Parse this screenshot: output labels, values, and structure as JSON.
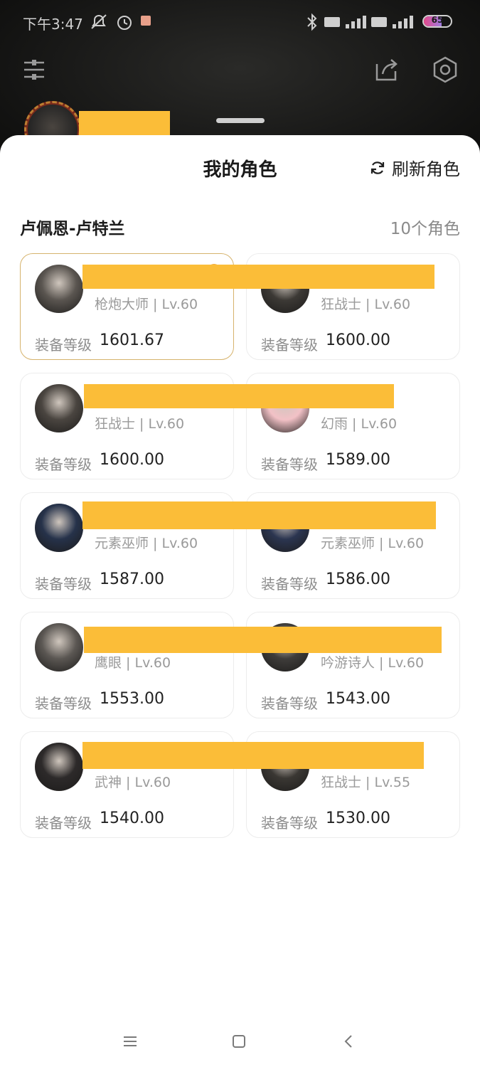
{
  "status": {
    "time": "下午3:47",
    "battery": "65",
    "battery_level": 0.65
  },
  "sheet": {
    "title": "我的角色",
    "refresh_label": "刷新角色",
    "server_name": "卢佩恩-卢特兰",
    "role_count": "10个角色"
  },
  "gear_label": "装备等级",
  "characters": [
    {
      "class_level": "枪炮大师 | Lv.60",
      "gear_score": "1601.67",
      "selected": true,
      "avatar_color": "#5a5550"
    },
    {
      "class_level": "狂战士 | Lv.60",
      "gear_score": "1600.00",
      "selected": false,
      "avatar_color": "#3c3935"
    },
    {
      "class_level": "狂战士 | Lv.60",
      "gear_score": "1600.00",
      "selected": false,
      "avatar_color": "#4a4540"
    },
    {
      "class_level": "幻雨 | Lv.60",
      "gear_score": "1589.00",
      "selected": false,
      "avatar_color": "#f2c1c6"
    },
    {
      "class_level": "元素巫师 | Lv.60",
      "gear_score": "1587.00",
      "selected": false,
      "avatar_color": "#26324a"
    },
    {
      "class_level": "元素巫师 | Lv.60",
      "gear_score": "1586.00",
      "selected": false,
      "avatar_color": "#2b3550"
    },
    {
      "class_level": "鹰眼 | Lv.60",
      "gear_score": "1553.00",
      "selected": false,
      "avatar_color": "#5b5753"
    },
    {
      "class_level": "吟游诗人 | Lv.60",
      "gear_score": "1543.00",
      "selected": false,
      "avatar_color": "#3e3c3a"
    },
    {
      "class_level": "武神 | Lv.60",
      "gear_score": "1540.00",
      "selected": false,
      "avatar_color": "#2d2a2a"
    },
    {
      "class_level": "狂战士 | Lv.55",
      "gear_score": "1530.00",
      "selected": false,
      "avatar_color": "#3a3733"
    }
  ],
  "colors": {
    "redaction": "#fbbd38",
    "selected_border": "#d6b36c",
    "accent_badge": "#f0a93b"
  },
  "icons": {
    "menu": "sliders-icon",
    "share": "share-icon",
    "settings": "hexagon-settings-icon",
    "refresh": "refresh-icon"
  }
}
